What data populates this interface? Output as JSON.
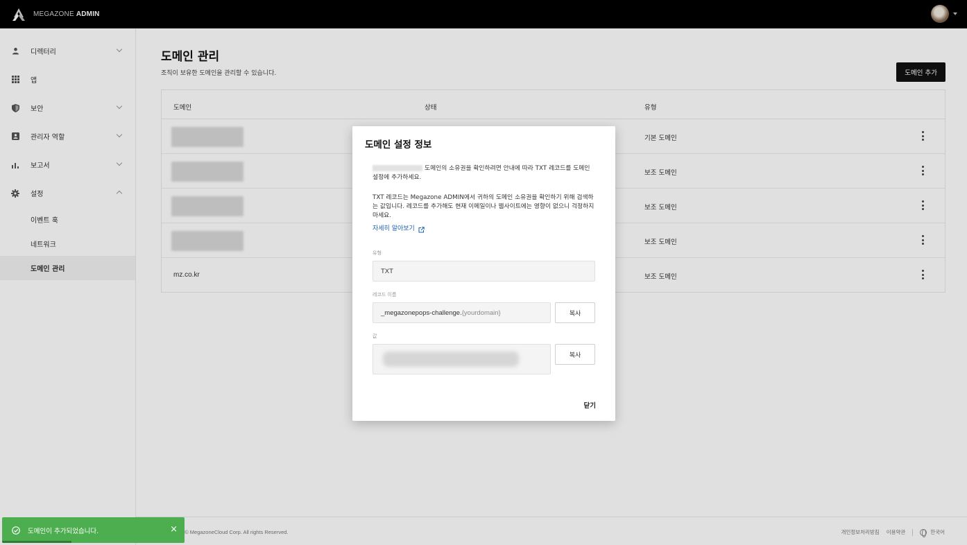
{
  "topbar": {
    "brand_main": "MEGAZONE",
    "brand_admin": "ADMIN"
  },
  "sidebar": {
    "items": [
      {
        "label": "디렉터리",
        "icon": "user-icon",
        "has_chevron": true
      },
      {
        "label": "앱",
        "icon": "grid-icon",
        "has_chevron": false
      },
      {
        "label": "보안",
        "icon": "shield-icon",
        "has_chevron": true
      },
      {
        "label": "관리자 역할",
        "icon": "badge-icon",
        "has_chevron": true
      },
      {
        "label": "보고서",
        "icon": "bar-chart-icon",
        "has_chevron": true
      },
      {
        "label": "설정",
        "icon": "gear-icon",
        "has_chevron": true,
        "expanded": true
      }
    ],
    "sub_items": [
      {
        "label": "이벤트 훅"
      },
      {
        "label": "네트워크"
      },
      {
        "label": "도메인 관리",
        "active": true
      }
    ]
  },
  "main": {
    "title": "도메인 관리",
    "description": "조직이 보유한 도메인을 관리할 수 있습니다.",
    "add_button": "도메인 추가",
    "table": {
      "headers": {
        "domain": "도메인",
        "state": "상태",
        "type": "유형"
      },
      "rows": [
        {
          "domain": "",
          "type": "기본 도메인",
          "blurred": true
        },
        {
          "domain": "",
          "type": "보조 도메인",
          "blurred": true
        },
        {
          "domain": "",
          "type": "보조 도메인",
          "blurred": true
        },
        {
          "domain": "",
          "type": "보조 도메인",
          "blurred": true
        },
        {
          "domain": "mz.co.kr",
          "type": "보조 도메인",
          "blurred": false
        }
      ]
    }
  },
  "footer": {
    "copyright": "Copyright © MegazoneCloud Corp. All rights Reserved.",
    "privacy": "개인정보처리방침",
    "terms": "이용약관",
    "language": "한국어"
  },
  "modal": {
    "title": "도메인 설정 정보",
    "para1": "도메인의 소유권을 확인하려면 안내에 따라 TXT 레코드를 도메인 설정에 추가하세요.",
    "para2": "TXT 레코드는 Megazone ADMIN에서 귀하의 도메인 소유권을 확인하기 위해 검색하는 값입니다. 레코드를 추가해도 현재 이메일이나 웹사이트에는 영향이 없으니 걱정하지 마세요.",
    "learn_more": "자세히 알아보기",
    "type_label": "유형",
    "type_value": "TXT",
    "record_label": "레코드 이름",
    "record_value": "_megazonepops-challenge.",
    "record_suffix": "{yourdomain}",
    "value_label": "값",
    "copy_label": "복사",
    "close_label": "닫기"
  },
  "toast": {
    "message": "도메인이 추가되었습니다.",
    "close": "×",
    "progress": 0.38,
    "color": "#4cae4f"
  }
}
